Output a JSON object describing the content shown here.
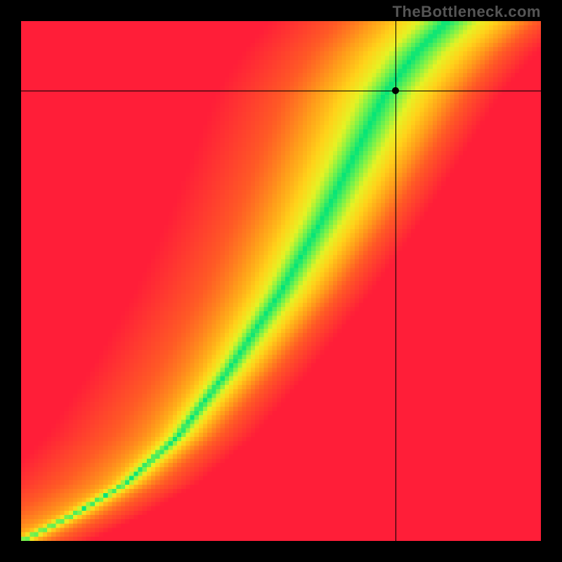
{
  "watermark": "TheBottleneck.com",
  "chart_data": {
    "type": "heatmap",
    "title": "",
    "xlabel": "",
    "ylabel": "",
    "xlim": [
      0,
      1
    ],
    "ylim": [
      0,
      1
    ],
    "grid_size": 120,
    "crosshair": {
      "x": 0.72,
      "y": 0.866
    },
    "ridge": {
      "description": "Green optimal-balance ridge through a red→yellow bottleneck field",
      "control_points_xy": [
        [
          0.0,
          0.0
        ],
        [
          0.1,
          0.05
        ],
        [
          0.2,
          0.11
        ],
        [
          0.3,
          0.2
        ],
        [
          0.4,
          0.33
        ],
        [
          0.5,
          0.48
        ],
        [
          0.58,
          0.62
        ],
        [
          0.64,
          0.74
        ],
        [
          0.7,
          0.86
        ],
        [
          0.76,
          0.94
        ],
        [
          0.82,
          1.0
        ]
      ],
      "width_y": [
        [
          0.0,
          0.01
        ],
        [
          0.1,
          0.012
        ],
        [
          0.2,
          0.018
        ],
        [
          0.3,
          0.024
        ],
        [
          0.4,
          0.032
        ],
        [
          0.5,
          0.04
        ],
        [
          0.6,
          0.048
        ],
        [
          0.7,
          0.055
        ],
        [
          0.8,
          0.062
        ],
        [
          0.9,
          0.068
        ],
        [
          1.0,
          0.075
        ]
      ]
    },
    "colormap_stops": [
      {
        "t": 0.0,
        "hex": "#00e47a"
      },
      {
        "t": 0.2,
        "hex": "#7af24a"
      },
      {
        "t": 0.35,
        "hex": "#e6f224"
      },
      {
        "t": 0.5,
        "hex": "#ffd21a"
      },
      {
        "t": 0.65,
        "hex": "#ff9e1a"
      },
      {
        "t": 0.8,
        "hex": "#ff5a25"
      },
      {
        "t": 1.0,
        "hex": "#ff1e38"
      }
    ]
  }
}
